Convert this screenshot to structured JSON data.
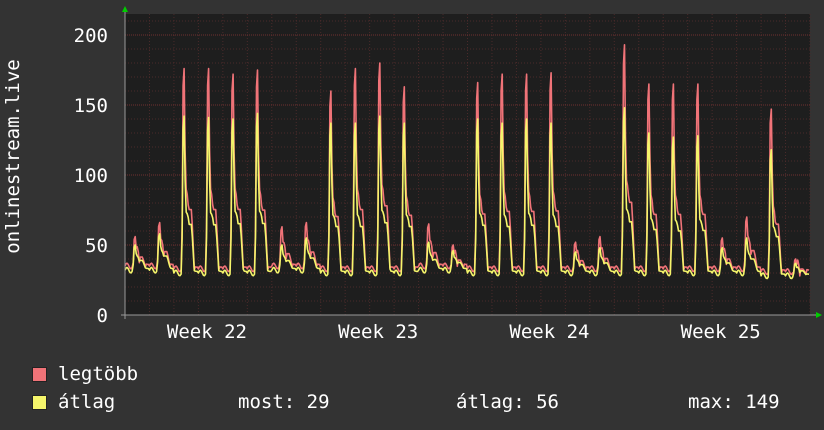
{
  "chart_data": {
    "type": "line",
    "ylabel": "onlinestream.live",
    "ylim": [
      0,
      215
    ],
    "yticks": [
      0,
      50,
      100,
      150,
      200
    ],
    "x_week_labels": [
      "Week 22",
      "Week 23",
      "Week 24",
      "Week 25"
    ],
    "grid": true,
    "legend_position": "bottom-left",
    "colors": {
      "background": "#333333",
      "plot_background": "#1e1e1e",
      "grid_minor": "#4a2a2a",
      "grid_major": "#703030",
      "axis": "#999999",
      "arrow": "#00cc00",
      "max_series": "#f07378",
      "avg_series": "#f5f56b"
    },
    "days": [
      {
        "peak_max": 56,
        "peak_avg": 50,
        "low": 32,
        "sub": 0.78
      },
      {
        "peak_max": 66,
        "peak_avg": 58,
        "low": 32,
        "sub": 0.78
      },
      {
        "peak_max": 176,
        "peak_avg": 142,
        "low": 30,
        "sub": 0.62
      },
      {
        "peak_max": 176,
        "peak_avg": 141,
        "low": 30,
        "sub": 0.62
      },
      {
        "peak_max": 172,
        "peak_avg": 140,
        "low": 30,
        "sub": 0.64
      },
      {
        "peak_max": 175,
        "peak_avg": 144,
        "low": 30,
        "sub": 0.62
      },
      {
        "peak_max": 63,
        "peak_avg": 50,
        "low": 32,
        "sub": 0.76
      },
      {
        "peak_max": 66,
        "peak_avg": 55,
        "low": 32,
        "sub": 0.76
      },
      {
        "peak_max": 160,
        "peak_avg": 137,
        "low": 30,
        "sub": 0.62
      },
      {
        "peak_max": 176,
        "peak_avg": 137,
        "low": 30,
        "sub": 0.62
      },
      {
        "peak_max": 180,
        "peak_avg": 142,
        "low": 30,
        "sub": 0.64
      },
      {
        "peak_max": 163,
        "peak_avg": 137,
        "low": 30,
        "sub": 0.62
      },
      {
        "peak_max": 65,
        "peak_avg": 52,
        "low": 32,
        "sub": 0.76
      },
      {
        "peak_max": 50,
        "peak_avg": 46,
        "low": 32,
        "sub": 0.8
      },
      {
        "peak_max": 166,
        "peak_avg": 140,
        "low": 30,
        "sub": 0.62
      },
      {
        "peak_max": 172,
        "peak_avg": 137,
        "low": 30,
        "sub": 0.62
      },
      {
        "peak_max": 172,
        "peak_avg": 140,
        "low": 30,
        "sub": 0.62
      },
      {
        "peak_max": 173,
        "peak_avg": 137,
        "low": 30,
        "sub": 0.62
      },
      {
        "peak_max": 52,
        "peak_avg": 45,
        "low": 30,
        "sub": 0.8
      },
      {
        "peak_max": 56,
        "peak_avg": 48,
        "low": 30,
        "sub": 0.8
      },
      {
        "peak_max": 193,
        "peak_avg": 148,
        "low": 30,
        "sub": 0.62
      },
      {
        "peak_max": 165,
        "peak_avg": 130,
        "low": 30,
        "sub": 0.62
      },
      {
        "peak_max": 165,
        "peak_avg": 127,
        "low": 30,
        "sub": 0.62
      },
      {
        "peak_max": 165,
        "peak_avg": 128,
        "low": 30,
        "sub": 0.62
      },
      {
        "peak_max": 55,
        "peak_avg": 48,
        "low": 30,
        "sub": 0.8
      },
      {
        "peak_max": 70,
        "peak_avg": 55,
        "low": 30,
        "sub": 0.8
      },
      {
        "peak_max": 147,
        "peak_avg": 118,
        "low": 28,
        "sub": 0.62
      },
      {
        "peak_max": 40,
        "peak_avg": 37,
        "low": 28,
        "sub": 0.8
      }
    ]
  },
  "legend": {
    "max_label": "legtöbb",
    "avg_label": "átlag",
    "stats": {
      "now": "most: 29",
      "avg": "átlag: 56",
      "max": "max: 149"
    }
  }
}
